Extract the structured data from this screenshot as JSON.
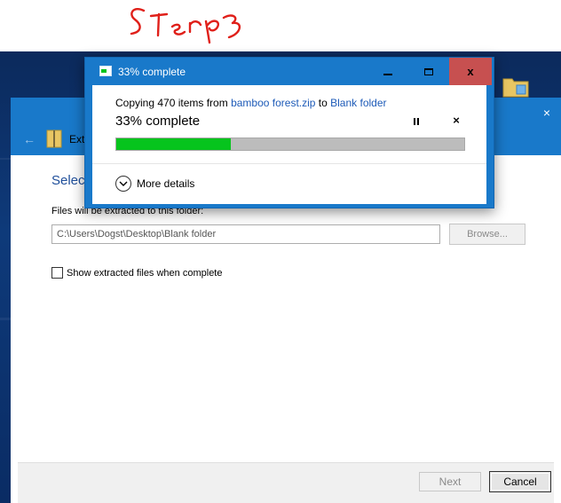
{
  "annotation": {
    "text": "Step 3",
    "color": "#e0201a"
  },
  "progress_dialog": {
    "title": "33% complete",
    "copy_prefix": "Copying 470 items from ",
    "source": "bamboo forest.zip",
    "copy_middle": " to ",
    "destination": "Blank folder",
    "percent_text": "33% complete",
    "progress_fraction": 0.33,
    "more_details_label": "More details",
    "close_glyph": "x",
    "stop_glyph": "×"
  },
  "wizard": {
    "nav_title": "Ext",
    "heading": "Selec",
    "close_glyph": "×",
    "files_label": "Files will be extracted to this folder:",
    "path_value": "C:\\Users\\Dogst\\Desktop\\Blank folder",
    "browse_label": "Browse...",
    "show_files_label": "Show extracted files when complete",
    "show_files_checked": false,
    "next_label": "Next",
    "cancel_label": "Cancel"
  },
  "colors": {
    "title_blue": "#1979ca",
    "link_blue": "#1e5bb8",
    "progress_green": "#06c41d",
    "close_red": "#c75050"
  }
}
